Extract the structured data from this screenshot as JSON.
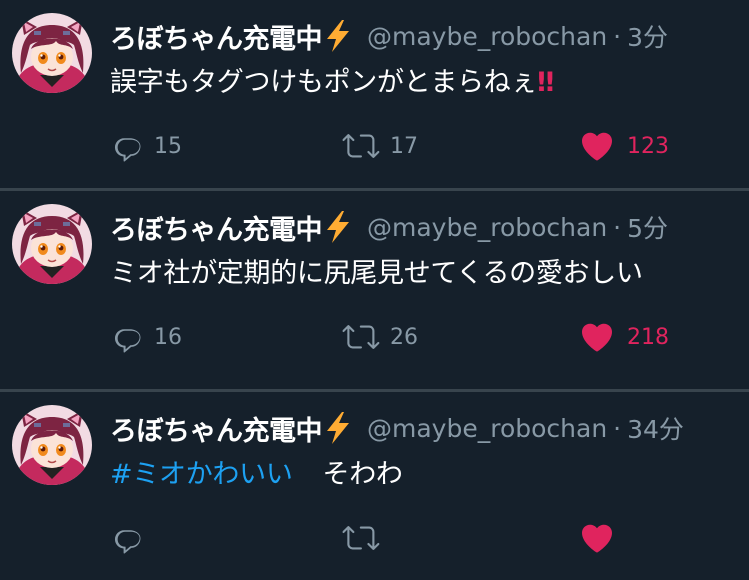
{
  "colors": {
    "background": "#15202b",
    "divider": "#38444d",
    "primary_text": "#ffffff",
    "secondary_text": "#8899a6",
    "link": "#1da1f2",
    "like": "#e0245e",
    "bolt": "#ffac33"
  },
  "icons": {
    "reply": "speech-bubble-icon",
    "retweet": "retweet-arrows-icon",
    "like": "heart-icon",
    "name_suffix": "lightning-bolt-icon"
  },
  "tweets": [
    {
      "display_name": "ろぼちゃん充電中",
      "handle": "@maybe_robochan",
      "separator": "·",
      "time": "3分",
      "hashtag": "",
      "text": "誤字もタグつけもポンがとまらねぇ",
      "emphasis": "‼",
      "reply_count": "15",
      "retweet_count": "17",
      "like_count": "123"
    },
    {
      "display_name": "ろぼちゃん充電中",
      "handle": "@maybe_robochan",
      "separator": "·",
      "time": "5分",
      "hashtag": "",
      "text": "ミオ社が定期的に尻尾見せてくるの愛おしい",
      "emphasis": "",
      "reply_count": "16",
      "retweet_count": "26",
      "like_count": "218"
    },
    {
      "display_name": "ろぼちゃん充電中",
      "handle": "@maybe_robochan",
      "separator": "·",
      "time": "34分",
      "hashtag": "#ミオかわいい",
      "text": "そわわ",
      "emphasis": "",
      "reply_count": "",
      "retweet_count": "",
      "like_count": ""
    }
  ]
}
